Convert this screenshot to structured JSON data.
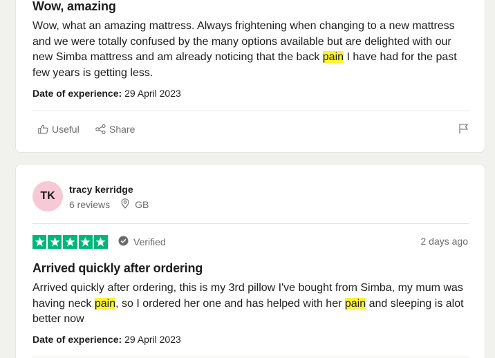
{
  "reviews": [
    {
      "title": "Wow, amazing",
      "body": [
        {
          "text": "Wow, what an amazing mattress. Always frightening when changing to a new mattress and we were totally confused by the many options available but are delighted with our new Simba mattress and am already noticing that the back ",
          "hl": false
        },
        {
          "text": "pain",
          "hl": true
        },
        {
          "text": " I have had for the past few years is getting less.",
          "hl": false
        }
      ],
      "date_label": "Date of experience:",
      "date_value": "29 April 2023",
      "actions": {
        "useful": "Useful",
        "share": "Share"
      }
    },
    {
      "reviewer": {
        "initials": "TK",
        "name": "tracy kerridge",
        "reviews": "6 reviews",
        "country": "GB"
      },
      "rating": 5,
      "verified": "Verified",
      "posted": "2 days ago",
      "title": "Arrived quickly after ordering",
      "body": [
        {
          "text": "Arrived quickly after ordering, this is my 3rd pillow I've bought from Simba, my mum was having neck ",
          "hl": false
        },
        {
          "text": "pain",
          "hl": true
        },
        {
          "text": ", so I ordered her one and has helped with her ",
          "hl": false
        },
        {
          "text": "pain",
          "hl": true
        },
        {
          "text": " and sleeping is alot better now",
          "hl": false
        }
      ],
      "date_label": "Date of experience:",
      "date_value": "29 April 2023"
    }
  ],
  "colors": {
    "star_green": "#00b67a",
    "highlight": "#fcf434",
    "avatar_bg": "#f7c8d6"
  },
  "icons": [
    "thumbs-up-icon",
    "share-icon",
    "flag-icon",
    "location-pin-icon",
    "star-icon",
    "verified-check-icon"
  ]
}
